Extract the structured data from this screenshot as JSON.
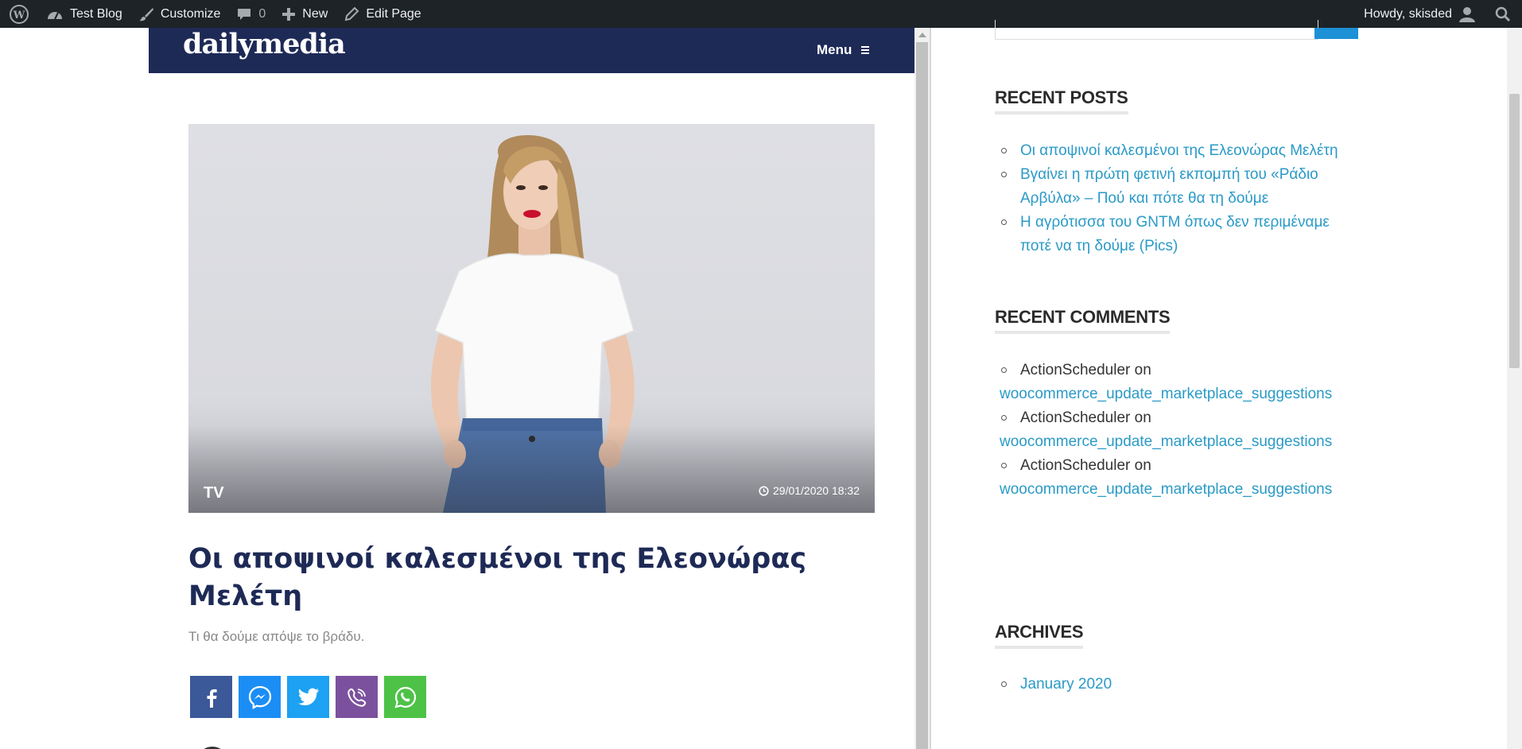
{
  "adminbar": {
    "site_name": "Test Blog",
    "customize": "Customize",
    "comments_count": "0",
    "new_label": "New",
    "edit_page": "Edit Page",
    "howdy": "Howdy, skisded"
  },
  "site": {
    "logo": "dailymedia",
    "menu_label": "Menu"
  },
  "article": {
    "category": "TV",
    "date": "29/01/2020 18:32",
    "title": "Οι αποψινοί καλεσμένοι της Ελεονώρας Μελέτη",
    "subtitle": "Τι θα δούμε απόψε το βράδυ."
  },
  "share_icons": [
    "facebook-icon",
    "messenger-icon",
    "twitter-icon",
    "viber-icon",
    "whatsapp-icon"
  ],
  "sidebar": {
    "recent_posts_title": "RECENT POSTS",
    "recent_posts": [
      "Οι αποψινοί καλεσμένοι της Ελεονώρας Μελέτη",
      "Βγαίνει η πρώτη φετινή εκπομπή του «Ράδιο Αρβύλα» – Πού και πότε θα τη δούμε",
      "Η αγρότισσα του GNTM όπως δεν περιμέναμε ποτέ να τη δούμε (Pics)"
    ],
    "recent_comments_title": "RECENT COMMENTS",
    "recent_comments": [
      {
        "author": "ActionScheduler",
        "on": "on",
        "link": "woocommerce_update_marketplace_suggestions"
      },
      {
        "author": "ActionScheduler",
        "on": "on",
        "link": "woocommerce_update_marketplace_suggestions"
      },
      {
        "author": "ActionScheduler",
        "on": "on",
        "link": "woocommerce_update_marketplace_suggestions"
      }
    ],
    "archives_title": "ARCHIVES",
    "archives": [
      "January 2020"
    ]
  },
  "colors": {
    "adminbar_bg": "#1d2327",
    "header_bg": "#1e2a56",
    "link": "#2a9ac7",
    "title": "#1e2a56"
  }
}
